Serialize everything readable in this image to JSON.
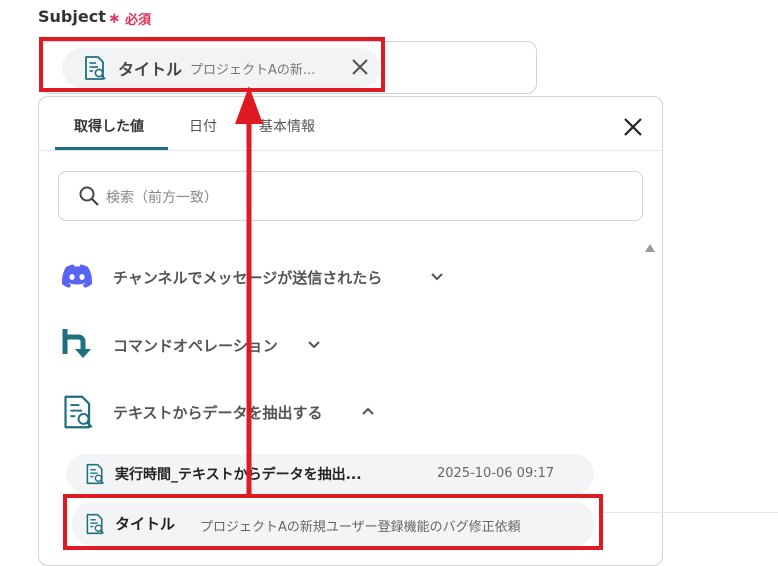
{
  "field": {
    "label": "Subject",
    "required_mark": "∗",
    "required_text": "必須"
  },
  "selected_chip": {
    "title": "タイトル",
    "value": "プロジェクトAの新..."
  },
  "tabs": [
    {
      "label": "取得した値",
      "active": true
    },
    {
      "label": "日付",
      "active": false
    },
    {
      "label": "基本情報",
      "active": false
    }
  ],
  "search": {
    "placeholder": "検索（前方一致）"
  },
  "sections": [
    {
      "label": "チャンネルでメッセージが送信されたら",
      "icon": "discord-icon",
      "expanded": false
    },
    {
      "label": "コマンドオペレーション",
      "icon": "command-operation-icon",
      "expanded": false
    },
    {
      "label": "テキストからデータを抽出する",
      "icon": "text-extract-icon",
      "expanded": true
    }
  ],
  "items": [
    {
      "title": "実行時間_テキストからデータを抽出...",
      "value": "2025-10-06 09:17"
    },
    {
      "title": "タイトル",
      "value": "プロジェクトAの新規ユーザー登録機能のバグ修正依頼"
    }
  ],
  "colors": {
    "accent": "#1f6f80",
    "required": "#e0315a",
    "annotation": "#e01a22",
    "discord": "#5865f2"
  }
}
